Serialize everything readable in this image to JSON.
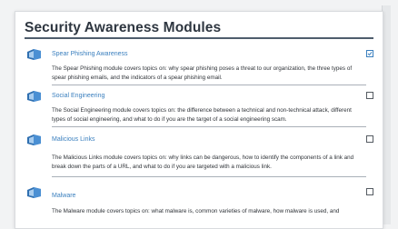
{
  "page": {
    "title": "Security Awareness Modules"
  },
  "modules": [
    {
      "title": "Spear Phishing Awareness",
      "checked": true,
      "description": "The Spear Phishing module covers topics on: why spear phishing poses a threat to our organization, the three types of spear phishing emails, and the indicators of a spear phishing email."
    },
    {
      "title": "Social Engineering",
      "checked": false,
      "description": "The Social Engineering module covers topics on: the difference between a technical and non-technical attack, different types of social engineering, and what to do if you are the target of a social engineering scam."
    },
    {
      "title": "Malicious Links",
      "checked": false,
      "description": "The Malicious Links module covers topics on: why links can be dangerous, how to identify the components of a link and break down the parts of a URL, and what to do if you are targeted with a malicious link."
    },
    {
      "title": "Malware",
      "checked": false,
      "description": "The Malware module covers topics on: what malware is, common varieties of malware, how malware is used, and"
    }
  ],
  "icons": {
    "module_icon": "book-icon",
    "checkbox_checked": "checkmark-icon"
  },
  "colors": {
    "accent": "#3a7fbe",
    "title_rule": "#4f5d6c",
    "text": "#2f3338"
  }
}
